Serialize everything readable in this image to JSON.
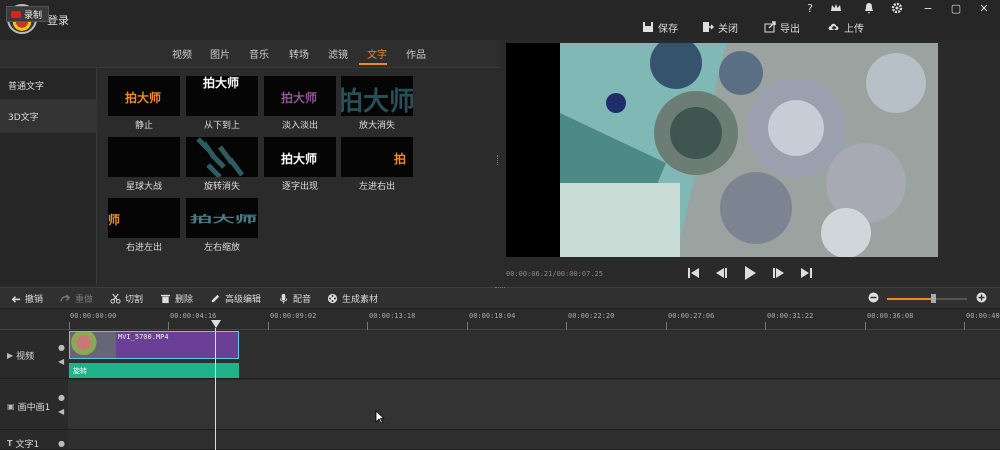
{
  "header": {
    "login_label": "登录",
    "window_controls": [
      "?",
      "−",
      "▢",
      "✕"
    ],
    "actions": [
      {
        "label": "保存",
        "icon": "save-icon"
      },
      {
        "label": "关闭",
        "icon": "close-project-icon"
      },
      {
        "label": "导出",
        "icon": "export-icon"
      },
      {
        "label": "上传",
        "icon": "upload-icon"
      }
    ]
  },
  "record_label": "录制",
  "tabs": [
    {
      "label": "视频"
    },
    {
      "label": "图片"
    },
    {
      "label": "音乐"
    },
    {
      "label": "转场"
    },
    {
      "label": "滤镜"
    },
    {
      "label": "文字",
      "active": true
    },
    {
      "label": "作品"
    }
  ],
  "categories": [
    "普通文字",
    "3D文字"
  ],
  "effects": [
    {
      "name": "静止",
      "sample": "拍大师"
    },
    {
      "name": "从下到上",
      "sample": "拍大师"
    },
    {
      "name": "淡入淡出",
      "sample": "拍大师"
    },
    {
      "name": "放大消失",
      "sample": "拍大师"
    },
    {
      "name": "星球大战",
      "sample": ""
    },
    {
      "name": "旋转消失",
      "sample": ""
    },
    {
      "name": "逐字出现",
      "sample": "拍大师"
    },
    {
      "name": "左进右出",
      "sample": "拍"
    },
    {
      "name": "右进左出",
      "sample": "师"
    },
    {
      "name": "左右缩放",
      "sample": "拍大师"
    }
  ],
  "preview": {
    "timecode": "00:00:06.21/00:00:07.25"
  },
  "toolbar": {
    "undo": "撤销",
    "redo": "重做",
    "cut": "切割",
    "delete": "删除",
    "advanced_edit": "高级编辑",
    "dub": "配音",
    "generate": "生成素材",
    "zoom_level": 0.58
  },
  "ruler": [
    "00:00:00:00",
    "00:00:04:16",
    "00:00:09:02",
    "00:00:13:18",
    "00:00:18:04",
    "00:00:22:20",
    "00:00:27:06",
    "00:00:31:22",
    "00:00:36:08",
    "00:00:40:"
  ],
  "tracks": [
    {
      "label": "视频"
    },
    {
      "label": "画中画1"
    },
    {
      "label": "文字1"
    }
  ],
  "clip": {
    "name": "MVI_5700.MP4",
    "effect_label": "旋转"
  },
  "colors": {
    "accent": "#f08a24",
    "clip": "#6a3f95",
    "effect": "#20b38a"
  }
}
